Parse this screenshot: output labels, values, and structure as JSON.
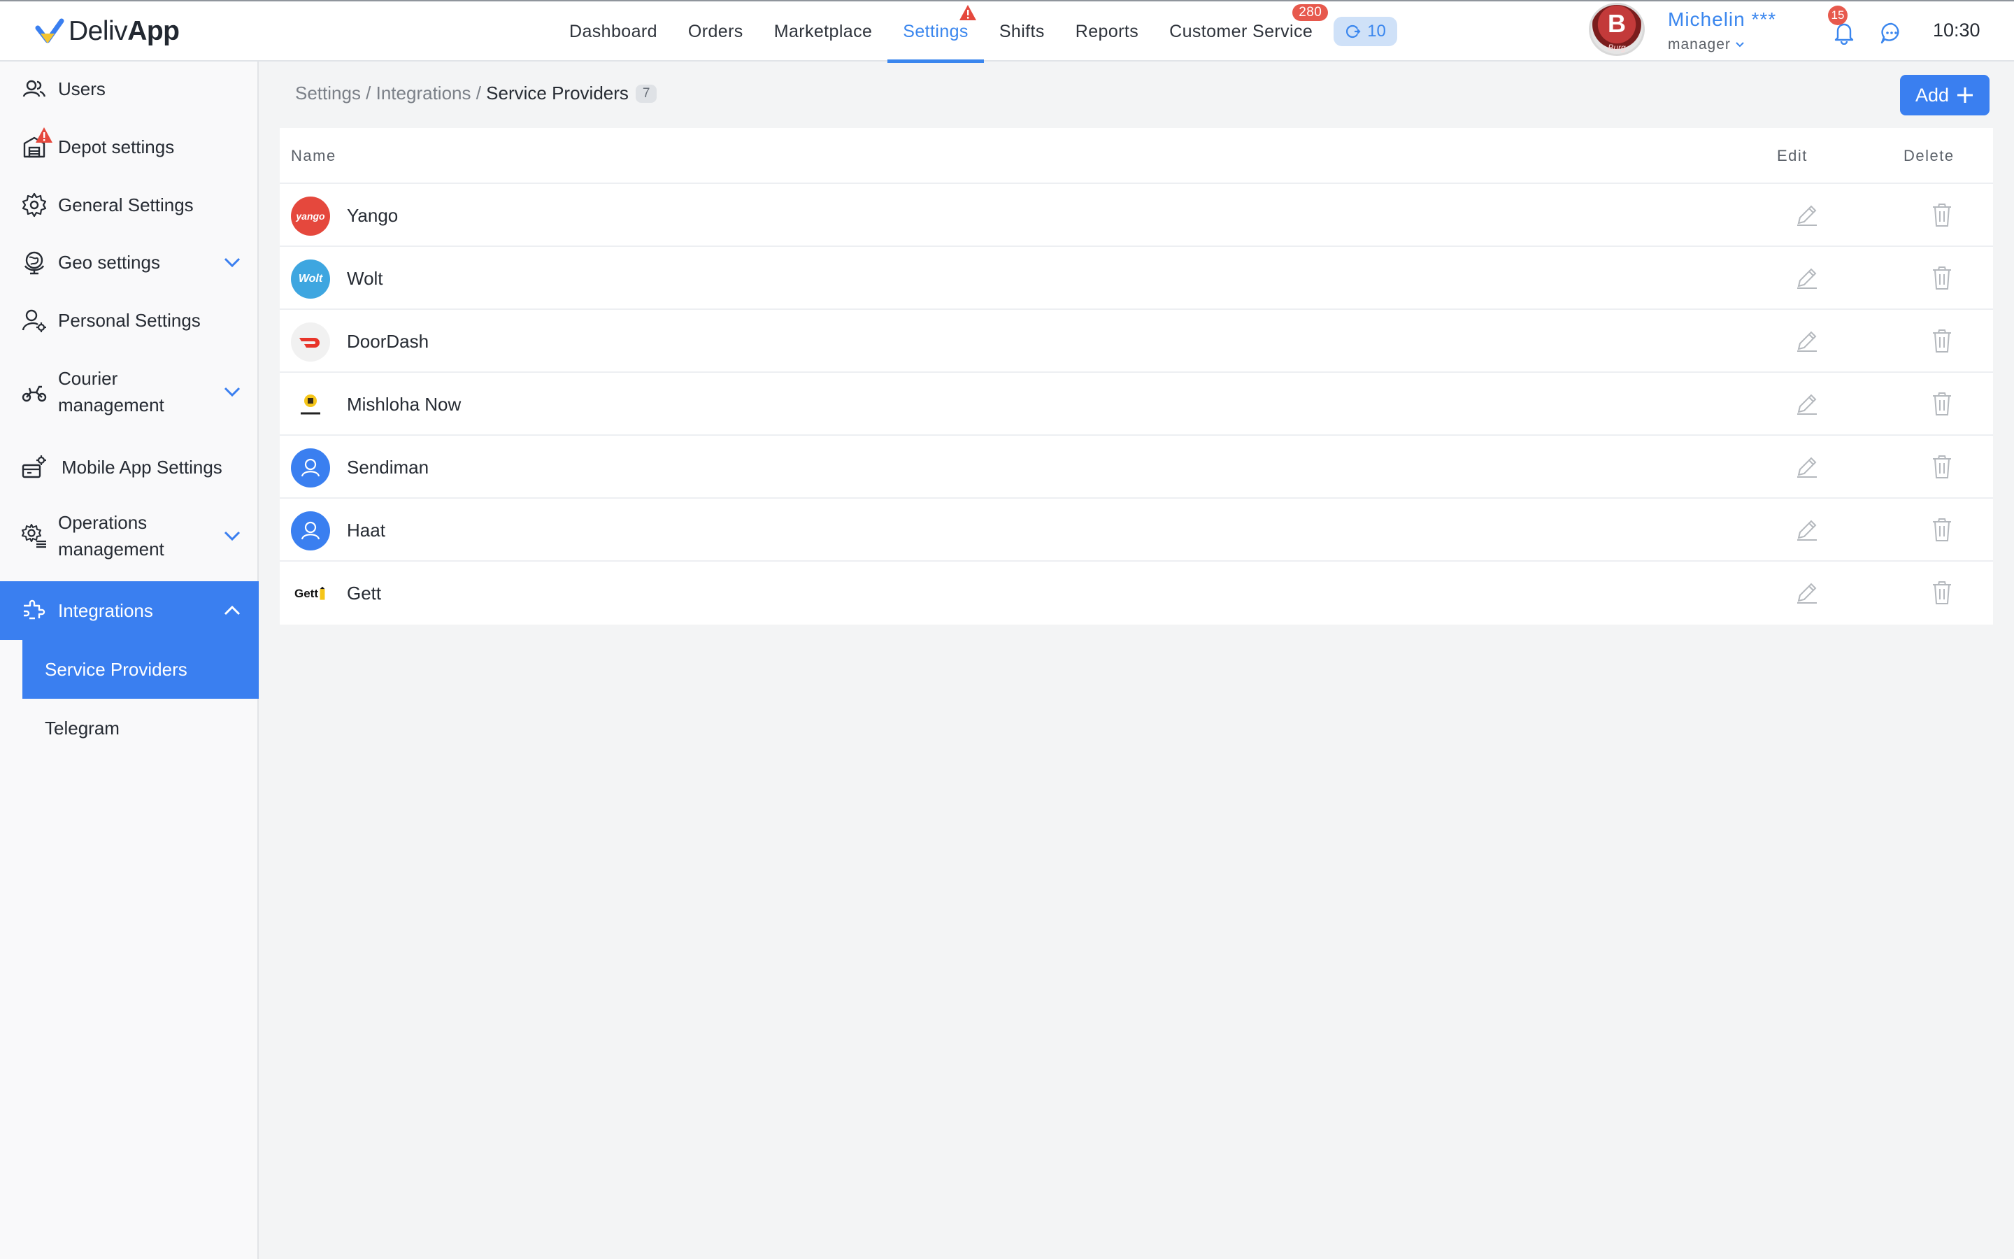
{
  "app": {
    "logo_text_light": "Deliv",
    "logo_text_bold": "App",
    "brand_color": "#3a7ff0"
  },
  "nav": {
    "items": [
      {
        "label": "Dashboard"
      },
      {
        "label": "Orders"
      },
      {
        "label": "Marketplace"
      },
      {
        "label": "Settings",
        "active": true
      },
      {
        "label": "Shifts"
      },
      {
        "label": "Reports"
      },
      {
        "label": "Customer Service",
        "badge": "280"
      }
    ],
    "chip_count": "10"
  },
  "user": {
    "avatar_letter": "B",
    "avatar_sub": "Burg",
    "name": "Michelin ***",
    "role": "manager",
    "notification_count": "15",
    "time": "10:30"
  },
  "sidebar": {
    "items": [
      {
        "label": "Users",
        "icon": "users-icon"
      },
      {
        "label": "Depot settings",
        "icon": "depot-icon"
      },
      {
        "label": "General Settings",
        "icon": "gear-icon"
      },
      {
        "label": "Geo settings",
        "icon": "globe-icon"
      },
      {
        "label": "Personal Settings",
        "icon": "user-gear-icon"
      },
      {
        "label_line1": "Courier",
        "label_line2": "management",
        "icon": "scooter-icon"
      },
      {
        "label": "Mobile App Settings",
        "icon": "mobile-settings-icon"
      },
      {
        "label_line1": "Operations",
        "label_line2": "management",
        "icon": "operations-icon"
      },
      {
        "label": "Integrations",
        "icon": "integrations-icon",
        "active": true
      }
    ],
    "sub_items": [
      {
        "label": "Service Providers",
        "active": true
      },
      {
        "label": "Telegram"
      }
    ]
  },
  "breadcrumb": {
    "part1": "Settings",
    "sep": " / ",
    "part2": "Integrations",
    "current": "Service Providers",
    "count": "7"
  },
  "toolbar": {
    "add_label": "Add"
  },
  "table": {
    "columns": {
      "name": "Name",
      "edit": "Edit",
      "delete": "Delete"
    },
    "rows": [
      {
        "name": "Yango",
        "logo_text": "yango",
        "logo_color": "#e5483d"
      },
      {
        "name": "Wolt",
        "logo_text": "Wolt",
        "logo_color": "#3ea6e0"
      },
      {
        "name": "DoorDash",
        "logo_text": "",
        "logo_color": "#f2f2f2"
      },
      {
        "name": "Mishloha Now",
        "logo_text": "",
        "logo_color": "#ffffff"
      },
      {
        "name": "Sendiman",
        "logo_text": "",
        "logo_color": "#3a7ff0"
      },
      {
        "name": "Haat",
        "logo_text": "",
        "logo_color": "#3a7ff0"
      },
      {
        "name": "Gett",
        "logo_text": "Gett",
        "logo_color": "#ffffff"
      }
    ]
  }
}
